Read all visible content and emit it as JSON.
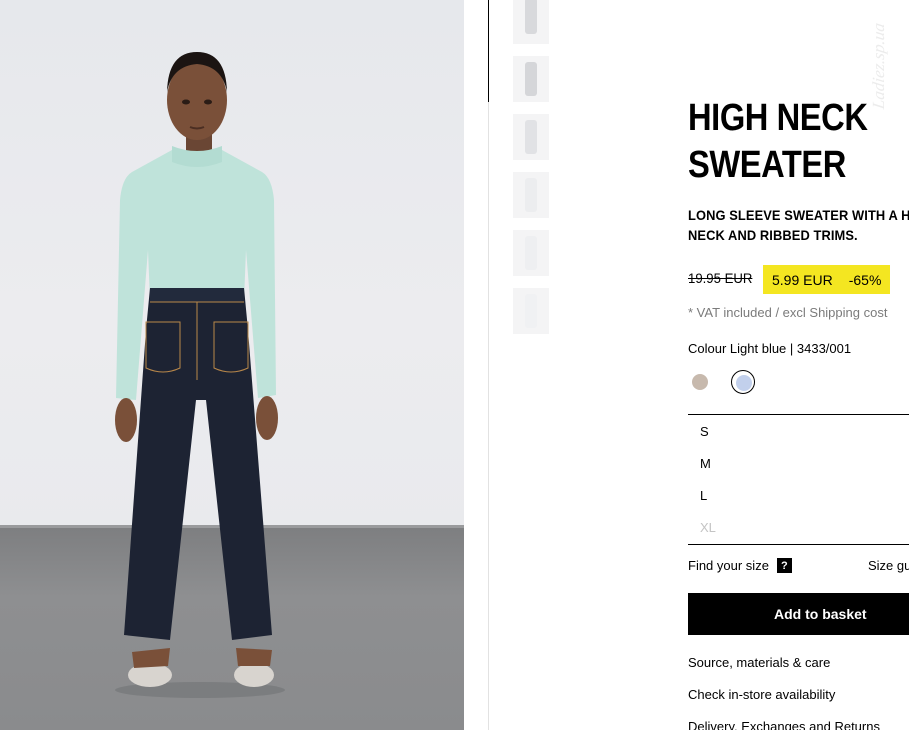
{
  "product": {
    "title_line1": "HIGH NECK",
    "title_line2": "SWEATER",
    "description_line1": "LONG SLEEVE SWEATER WITH A HI",
    "description_line2": "NECK AND RIBBED TRIMS.",
    "old_price": "19.95 EUR",
    "sale_price": "5.99 EUR",
    "discount": "-65%",
    "vat_note": "* VAT included / excl Shipping cost",
    "colour_text": "Colour Light blue | 3433/001"
  },
  "swatches": [
    {
      "name": "beige",
      "color": "#c7b9ad",
      "selected": false
    },
    {
      "name": "light-blue",
      "color": "#c2d0ec",
      "selected": true
    }
  ],
  "sizes": [
    {
      "label": "S",
      "available": true
    },
    {
      "label": "M",
      "available": true
    },
    {
      "label": "L",
      "available": true
    },
    {
      "label": "XL",
      "available": false
    }
  ],
  "size_help": {
    "find_your_size": "Find your size",
    "question_mark": "?",
    "size_guide": "Size gu"
  },
  "actions": {
    "add_to_basket": "Add to basket"
  },
  "links": [
    "Source, materials & care",
    "Check in-store availability",
    "Delivery, Exchanges and Returns"
  ],
  "watermark": "Ladiez.sp.ua",
  "colors": {
    "sale_highlight": "#f4e621",
    "button_bg": "#000000",
    "muted_text": "#7b7b7b",
    "disabled_size": "#c4c4c4"
  }
}
